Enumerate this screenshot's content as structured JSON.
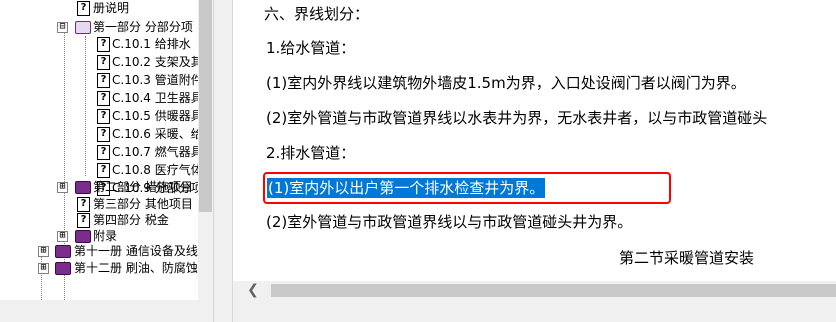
{
  "tree": {
    "items": [
      {
        "label": "册说明"
      },
      {
        "label": "第一部分 分部分项",
        "toggle": "⊟"
      },
      {
        "label": "C.10.1 给排水"
      },
      {
        "label": "C.10.2 支架及其"
      },
      {
        "label": "C.10.3 管道附件"
      },
      {
        "label": "C.10.4 卫生器具"
      },
      {
        "label": "C.10.5 供暖器具"
      },
      {
        "label": "C.10.6 采暖、给"
      },
      {
        "label": "C.10.7 燃气器具"
      },
      {
        "label": "C.10.8 医疗气体"
      },
      {
        "label": "C.10.9 分部分项"
      },
      {
        "label": "第二部分 措施项目",
        "toggle": "⊞"
      },
      {
        "label": "第三部分 其他项目"
      },
      {
        "label": "第四部分 税金"
      },
      {
        "label": "附录",
        "toggle": "⊞"
      },
      {
        "label": "第十一册 通信设备及线",
        "toggle": "⊞"
      },
      {
        "label": "第十二册 刷油、防腐蚀",
        "toggle": "⊞"
      }
    ]
  },
  "content": {
    "heading": "六、界线划分：",
    "water_supply_title": "1.给水管道：",
    "water_supply_1": "(1)室内外界线以建筑物外墙皮1.5m为界，入口处设阀门者以阀门为界。",
    "water_supply_2": "(2)室外管道与市政管道界线以水表井为界，无水表井者，以与市政管道碰头",
    "drainage_title": "2.排水管道：",
    "drainage_1": "(1)室内外以出户第一个排水检查井为界。",
    "drainage_2": "(2)室外管道与市政管道界线以与市政管道碰头井为界。",
    "section_title": "第二节采暖管道安装"
  },
  "icons": {
    "question_page": "help-topic-icon",
    "book_closed": "closed-book-icon",
    "book_open": "open-book-icon",
    "scroll_left": "scroll-left-arrow-icon"
  },
  "colors": {
    "selection": "#0078d7",
    "highlight_box": "#ff0000",
    "book": "#7b2c8c"
  }
}
